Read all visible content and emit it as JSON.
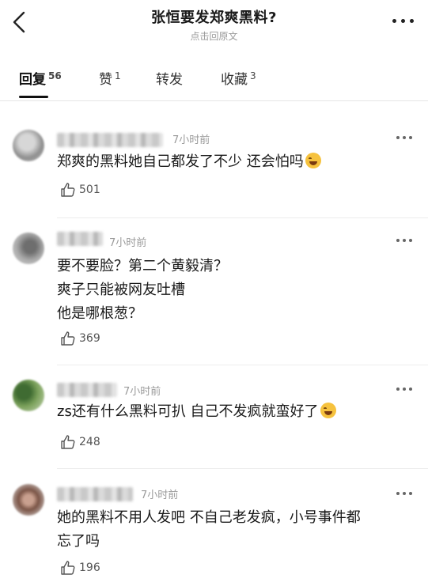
{
  "header": {
    "title": "张恒要发郑爽黑料?",
    "subtitle": "点击回原文"
  },
  "tabs": [
    {
      "label": "回复",
      "count": "56"
    },
    {
      "label": "赞",
      "count": "1"
    },
    {
      "label": "转发",
      "count": ""
    },
    {
      "label": "收藏",
      "count": "3"
    }
  ],
  "comments": [
    {
      "time": "7小时前",
      "lines": [
        "郑爽的黑料她自己都发了不少 还会怕吗"
      ],
      "emoji_last": true,
      "likes": "501"
    },
    {
      "time": "7小时前",
      "lines": [
        "要不要脸？第二个黄毅清？",
        "爽子只能被网友吐槽",
        "他是哪根葱？"
      ],
      "emoji_last": false,
      "likes": "369"
    },
    {
      "time": "7小时前",
      "lines": [
        "zs还有什么黑料可扒 自己不发疯就蛮好了"
      ],
      "emoji_last": true,
      "likes": "248"
    },
    {
      "time": "7小时前",
      "lines": [
        "她的黑料不用人发吧 不自己老发疯，小号事件都",
        "忘了吗"
      ],
      "emoji_last": false,
      "likes": "196"
    }
  ],
  "icons": [
    "back-arrow-icon",
    "more-dots-icon",
    "thumbs-up-icon",
    "laughing-emoji-icon"
  ]
}
